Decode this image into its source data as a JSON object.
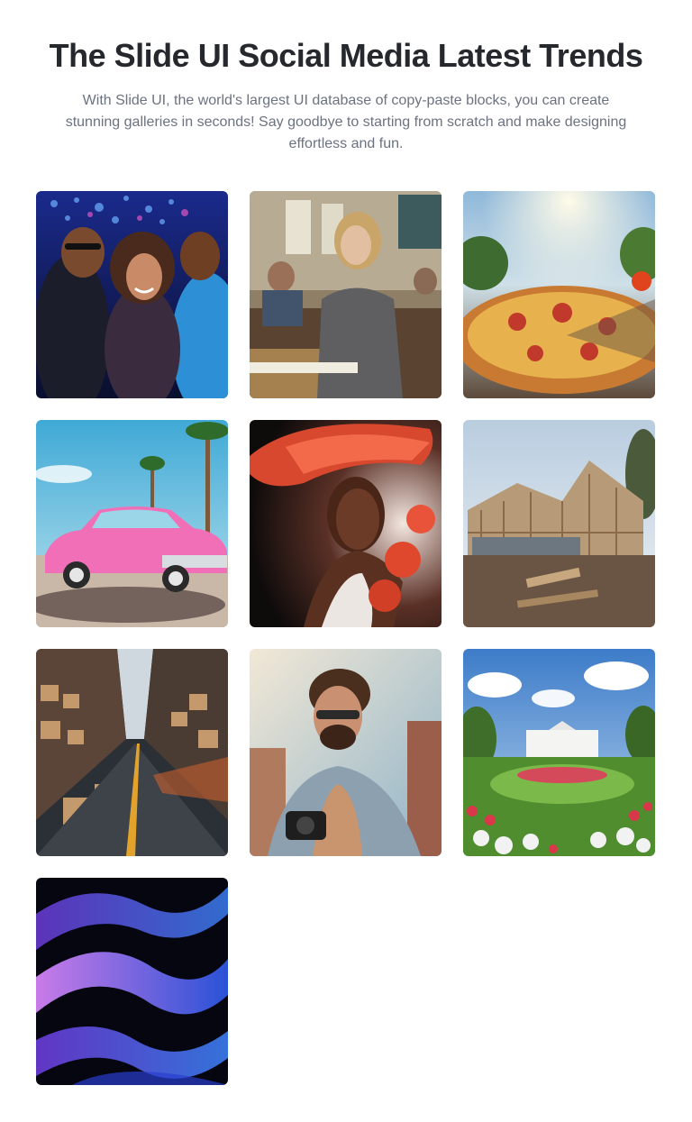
{
  "header": {
    "title": "The Slide UI Social Media Latest Trends",
    "subtitle": "With Slide UI, the world's largest UI database of copy-paste blocks, you can create stunning galleries in seconds! Say goodbye to starting from scratch and make designing effortless and fun."
  },
  "gallery": {
    "images": [
      {
        "name": "friends-party-photo"
      },
      {
        "name": "classroom-student-photo"
      },
      {
        "name": "pizza-photo"
      },
      {
        "name": "pink-classic-car-photo"
      },
      {
        "name": "woman-red-hat-photo"
      },
      {
        "name": "house-construction-photo"
      },
      {
        "name": "warehouse-photo"
      },
      {
        "name": "photographer-man-photo"
      },
      {
        "name": "white-house-garden-photo"
      },
      {
        "name": "abstract-waves-photo"
      }
    ]
  }
}
